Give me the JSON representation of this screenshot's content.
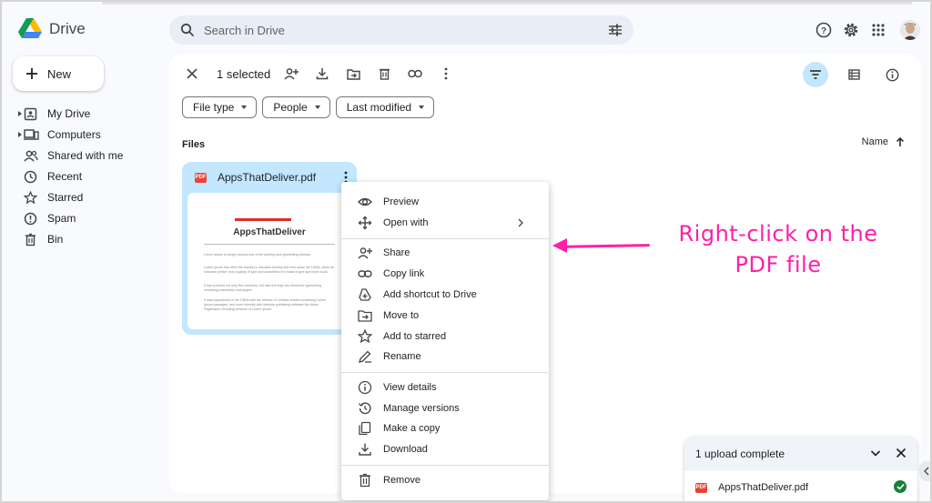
{
  "app": {
    "name": "Drive",
    "logo_icon": "google-drive-logo"
  },
  "search": {
    "placeholder": "Search in Drive",
    "icon": "search-icon",
    "filter_icon": "search-options-icon"
  },
  "header_icons": [
    "help-icon",
    "settings-icon",
    "apps-grid-icon",
    "account-avatar"
  ],
  "sidebar": {
    "new_label": "New",
    "items": [
      {
        "label": "My Drive",
        "icon": "my-drive-icon",
        "expandable": true
      },
      {
        "label": "Computers",
        "icon": "computers-icon",
        "expandable": true
      },
      {
        "label": "Shared with me",
        "icon": "shared-icon",
        "expandable": false
      },
      {
        "label": "Recent",
        "icon": "recent-icon",
        "expandable": false
      },
      {
        "label": "Starred",
        "icon": "star-icon",
        "expandable": false
      },
      {
        "label": "Spam",
        "icon": "spam-icon",
        "expandable": false
      },
      {
        "label": "Bin",
        "icon": "bin-icon",
        "expandable": false
      }
    ]
  },
  "toolbar": {
    "selected_label": "1 selected",
    "actions": [
      "close-selection-icon",
      "share-icon",
      "download-icon",
      "move-icon",
      "delete-icon",
      "copy-link-icon",
      "more-actions-icon"
    ],
    "view_buttons": [
      "filter-view-icon",
      "list-view-icon",
      "details-icon"
    ]
  },
  "filters": {
    "chips": [
      {
        "label": "File type"
      },
      {
        "label": "People"
      },
      {
        "label": "Last modified"
      }
    ]
  },
  "files": {
    "section_label": "Files",
    "sort_label": "Name",
    "sort_direction": "ascending",
    "items": [
      {
        "name": "AppsThatDeliver.pdf",
        "type_badge": "PDF",
        "preview_title": "AppsThatDeliver",
        "preview_paragraphs": [
          "Lorem Ipsum is simply dummy text of the printing and typesetting industry.",
          "Lorem Ipsum has been the industry's standard dummy text ever since the 1500s, when an unknown printer took a galley of type and scrambled it to make a type specimen book.",
          "It has survived not only five centuries, but also the leap into electronic typesetting, remaining essentially unchanged.",
          "It was popularised in the 1960s with the release of Letraset sheets containing Lorem Ipsum passages, and more recently with desktop publishing software like Aldus PageMaker including versions of Lorem Ipsum."
        ]
      }
    ]
  },
  "context_menu": {
    "groups": [
      [
        {
          "label": "Preview",
          "icon": "eye-icon"
        },
        {
          "label": "Open with",
          "icon": "open-with-icon",
          "submenu": true
        }
      ],
      [
        {
          "label": "Share",
          "icon": "share-icon"
        },
        {
          "label": "Copy link",
          "icon": "link-icon"
        },
        {
          "label": "Add shortcut to Drive",
          "icon": "add-shortcut-icon"
        },
        {
          "label": "Move to",
          "icon": "move-to-icon"
        },
        {
          "label": "Add to starred",
          "icon": "star-icon"
        },
        {
          "label": "Rename",
          "icon": "rename-icon"
        }
      ],
      [
        {
          "label": "View details",
          "icon": "info-icon"
        },
        {
          "label": "Manage versions",
          "icon": "history-icon"
        },
        {
          "label": "Make a copy",
          "icon": "copy-icon"
        },
        {
          "label": "Download",
          "icon": "download-icon"
        }
      ],
      [
        {
          "label": "Remove",
          "icon": "trash-icon"
        }
      ]
    ]
  },
  "annotation": {
    "line1": "Right-click on the",
    "line2": "PDF file",
    "color": "#ff1fa8"
  },
  "upload_panel": {
    "title": "1 upload complete",
    "file_name": "AppsThatDeliver.pdf",
    "file_badge": "PDF",
    "status": "complete"
  },
  "colors": {
    "selected_card": "#c2e7ff",
    "active_view": "#c2e7ff",
    "search_bg": "#e9eef6",
    "success": "#188038",
    "pdf_red": "#ea4335"
  }
}
